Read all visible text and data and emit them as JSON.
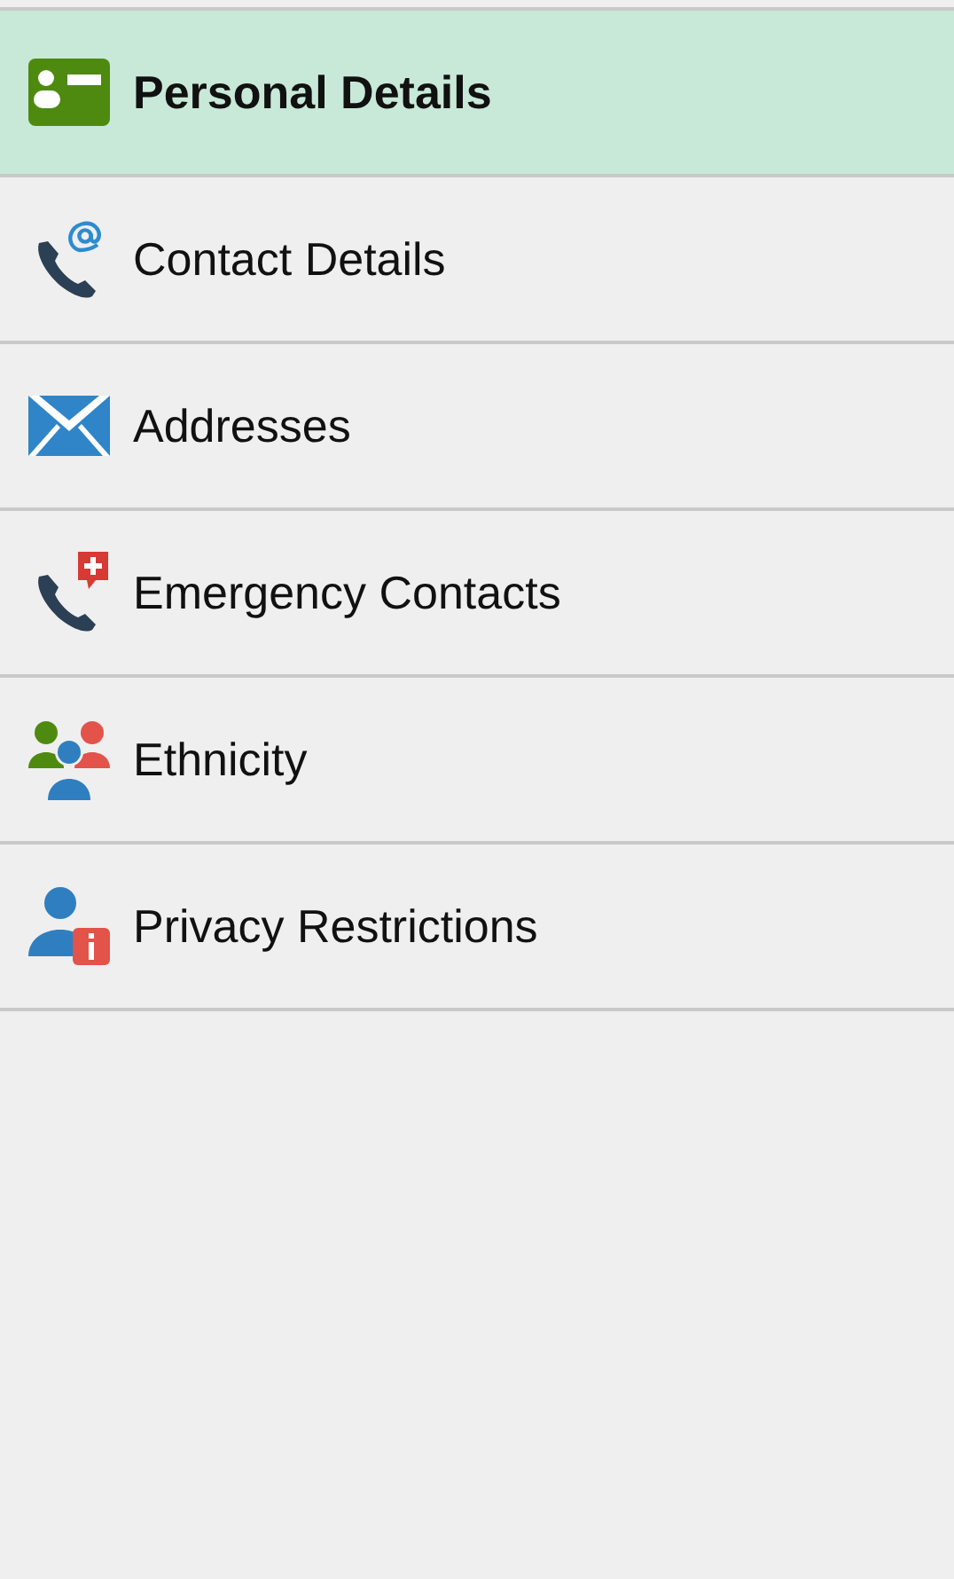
{
  "menu": [
    {
      "label": "Personal Details",
      "kind": "id-card",
      "selected": true
    },
    {
      "label": "Contact Details",
      "kind": "phone-at",
      "selected": false
    },
    {
      "label": "Addresses",
      "kind": "envelope",
      "selected": false
    },
    {
      "label": "Emergency Contacts",
      "kind": "phone-cross",
      "selected": false
    },
    {
      "label": "Ethnicity",
      "kind": "people",
      "selected": false
    },
    {
      "label": "Privacy Restrictions",
      "kind": "person-info",
      "selected": false
    }
  ]
}
